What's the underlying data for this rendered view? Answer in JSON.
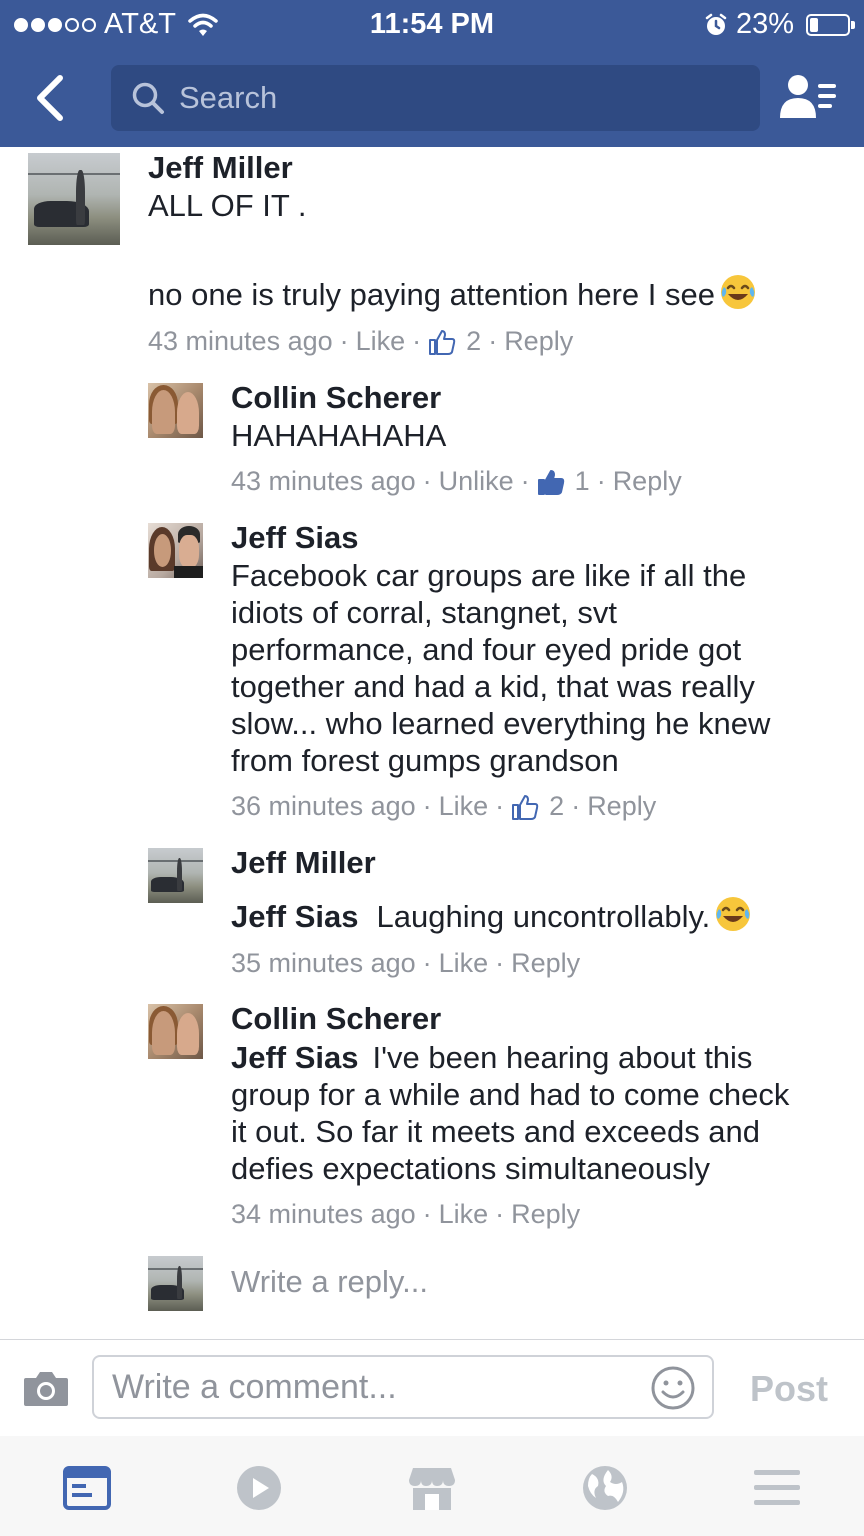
{
  "status_bar": {
    "carrier": "AT&T",
    "time": "11:54 PM",
    "battery": "23%",
    "battery_level": 0.23
  },
  "search": {
    "placeholder": "Search"
  },
  "comment": {
    "author": "Jeff Miller",
    "text_lines": [
      "ALL OF IT .",
      "",
      "no one is truly paying attention here I see"
    ],
    "timestamp": "43 minutes ago",
    "like_label": "Like",
    "like_count": "2",
    "reply_label": "Reply",
    "emoji": "joy-emoji"
  },
  "replies": [
    {
      "author": "Collin Scherer",
      "text": "HAHAHAHAHA",
      "timestamp": "43 minutes ago",
      "like_label": "Unlike",
      "like_count": "1",
      "reply_label": "Reply"
    },
    {
      "author": "Jeff Sias",
      "text_lines": [
        "Facebook car groups are like if all the",
        "idiots of corral, stangnet, svt",
        "performance, and four eyed pride got",
        "together and had a kid, that was really",
        "slow... who learned everything he knew",
        "from forest gumps grandson"
      ],
      "timestamp": "36 minutes ago",
      "like_label": "Like",
      "like_count": "2",
      "reply_label": "Reply"
    },
    {
      "author": "Jeff Miller",
      "tag": "Jeff Sias",
      "text": "Laughing uncontrollably.",
      "timestamp": "35 minutes ago",
      "like_label": "Like",
      "reply_label": "Reply"
    },
    {
      "author": "Collin Scherer",
      "tag": "Jeff Sias",
      "text_lines": [
        "I've been hearing about this",
        "group for a while and had to come check",
        "it out. So far it meets and exceeds and",
        "defies expectations simultaneously"
      ],
      "timestamp": "34 minutes ago",
      "like_label": "Like",
      "reply_label": "Reply"
    }
  ],
  "reply_box": {
    "placeholder": "Write a reply..."
  },
  "composer": {
    "placeholder": "Write a comment...",
    "post_label": "Post"
  },
  "tabs": [
    "news-feed-icon",
    "video-icon",
    "marketplace-icon",
    "notifications-globe-icon",
    "menu-icon"
  ],
  "colors": {
    "header": "#3b5998",
    "meta": "#90949c",
    "active_tab": "#4267b2"
  }
}
